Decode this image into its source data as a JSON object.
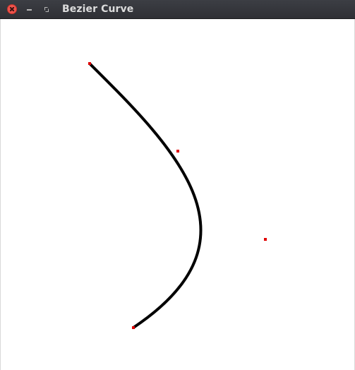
{
  "window": {
    "title": "Bezier Curve",
    "close_icon": "close-icon",
    "minimize_icon": "minimize-icon",
    "maximize_icon": "maximize-icon"
  },
  "curve": {
    "type": "cubic-bezier",
    "stroke_color": "#000000",
    "point_color": "#e00000"
  }
}
